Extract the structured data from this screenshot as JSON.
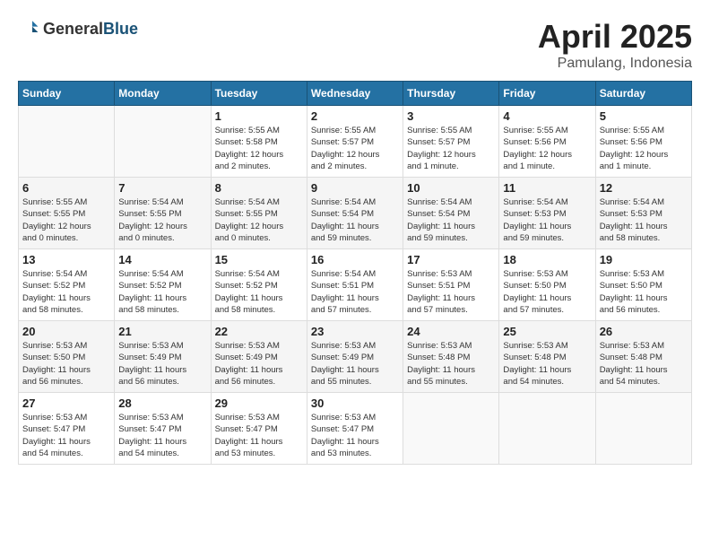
{
  "header": {
    "logo_general": "General",
    "logo_blue": "Blue",
    "month": "April 2025",
    "location": "Pamulang, Indonesia"
  },
  "weekdays": [
    "Sunday",
    "Monday",
    "Tuesday",
    "Wednesday",
    "Thursday",
    "Friday",
    "Saturday"
  ],
  "weeks": [
    [
      {
        "day": "",
        "info": ""
      },
      {
        "day": "",
        "info": ""
      },
      {
        "day": "1",
        "info": "Sunrise: 5:55 AM\nSunset: 5:58 PM\nDaylight: 12 hours\nand 2 minutes."
      },
      {
        "day": "2",
        "info": "Sunrise: 5:55 AM\nSunset: 5:57 PM\nDaylight: 12 hours\nand 2 minutes."
      },
      {
        "day": "3",
        "info": "Sunrise: 5:55 AM\nSunset: 5:57 PM\nDaylight: 12 hours\nand 1 minute."
      },
      {
        "day": "4",
        "info": "Sunrise: 5:55 AM\nSunset: 5:56 PM\nDaylight: 12 hours\nand 1 minute."
      },
      {
        "day": "5",
        "info": "Sunrise: 5:55 AM\nSunset: 5:56 PM\nDaylight: 12 hours\nand 1 minute."
      }
    ],
    [
      {
        "day": "6",
        "info": "Sunrise: 5:55 AM\nSunset: 5:55 PM\nDaylight: 12 hours\nand 0 minutes."
      },
      {
        "day": "7",
        "info": "Sunrise: 5:54 AM\nSunset: 5:55 PM\nDaylight: 12 hours\nand 0 minutes."
      },
      {
        "day": "8",
        "info": "Sunrise: 5:54 AM\nSunset: 5:55 PM\nDaylight: 12 hours\nand 0 minutes."
      },
      {
        "day": "9",
        "info": "Sunrise: 5:54 AM\nSunset: 5:54 PM\nDaylight: 11 hours\nand 59 minutes."
      },
      {
        "day": "10",
        "info": "Sunrise: 5:54 AM\nSunset: 5:54 PM\nDaylight: 11 hours\nand 59 minutes."
      },
      {
        "day": "11",
        "info": "Sunrise: 5:54 AM\nSunset: 5:53 PM\nDaylight: 11 hours\nand 59 minutes."
      },
      {
        "day": "12",
        "info": "Sunrise: 5:54 AM\nSunset: 5:53 PM\nDaylight: 11 hours\nand 58 minutes."
      }
    ],
    [
      {
        "day": "13",
        "info": "Sunrise: 5:54 AM\nSunset: 5:52 PM\nDaylight: 11 hours\nand 58 minutes."
      },
      {
        "day": "14",
        "info": "Sunrise: 5:54 AM\nSunset: 5:52 PM\nDaylight: 11 hours\nand 58 minutes."
      },
      {
        "day": "15",
        "info": "Sunrise: 5:54 AM\nSunset: 5:52 PM\nDaylight: 11 hours\nand 58 minutes."
      },
      {
        "day": "16",
        "info": "Sunrise: 5:54 AM\nSunset: 5:51 PM\nDaylight: 11 hours\nand 57 minutes."
      },
      {
        "day": "17",
        "info": "Sunrise: 5:53 AM\nSunset: 5:51 PM\nDaylight: 11 hours\nand 57 minutes."
      },
      {
        "day": "18",
        "info": "Sunrise: 5:53 AM\nSunset: 5:50 PM\nDaylight: 11 hours\nand 57 minutes."
      },
      {
        "day": "19",
        "info": "Sunrise: 5:53 AM\nSunset: 5:50 PM\nDaylight: 11 hours\nand 56 minutes."
      }
    ],
    [
      {
        "day": "20",
        "info": "Sunrise: 5:53 AM\nSunset: 5:50 PM\nDaylight: 11 hours\nand 56 minutes."
      },
      {
        "day": "21",
        "info": "Sunrise: 5:53 AM\nSunset: 5:49 PM\nDaylight: 11 hours\nand 56 minutes."
      },
      {
        "day": "22",
        "info": "Sunrise: 5:53 AM\nSunset: 5:49 PM\nDaylight: 11 hours\nand 56 minutes."
      },
      {
        "day": "23",
        "info": "Sunrise: 5:53 AM\nSunset: 5:49 PM\nDaylight: 11 hours\nand 55 minutes."
      },
      {
        "day": "24",
        "info": "Sunrise: 5:53 AM\nSunset: 5:48 PM\nDaylight: 11 hours\nand 55 minutes."
      },
      {
        "day": "25",
        "info": "Sunrise: 5:53 AM\nSunset: 5:48 PM\nDaylight: 11 hours\nand 54 minutes."
      },
      {
        "day": "26",
        "info": "Sunrise: 5:53 AM\nSunset: 5:48 PM\nDaylight: 11 hours\nand 54 minutes."
      }
    ],
    [
      {
        "day": "27",
        "info": "Sunrise: 5:53 AM\nSunset: 5:47 PM\nDaylight: 11 hours\nand 54 minutes."
      },
      {
        "day": "28",
        "info": "Sunrise: 5:53 AM\nSunset: 5:47 PM\nDaylight: 11 hours\nand 54 minutes."
      },
      {
        "day": "29",
        "info": "Sunrise: 5:53 AM\nSunset: 5:47 PM\nDaylight: 11 hours\nand 53 minutes."
      },
      {
        "day": "30",
        "info": "Sunrise: 5:53 AM\nSunset: 5:47 PM\nDaylight: 11 hours\nand 53 minutes."
      },
      {
        "day": "",
        "info": ""
      },
      {
        "day": "",
        "info": ""
      },
      {
        "day": "",
        "info": ""
      }
    ]
  ]
}
